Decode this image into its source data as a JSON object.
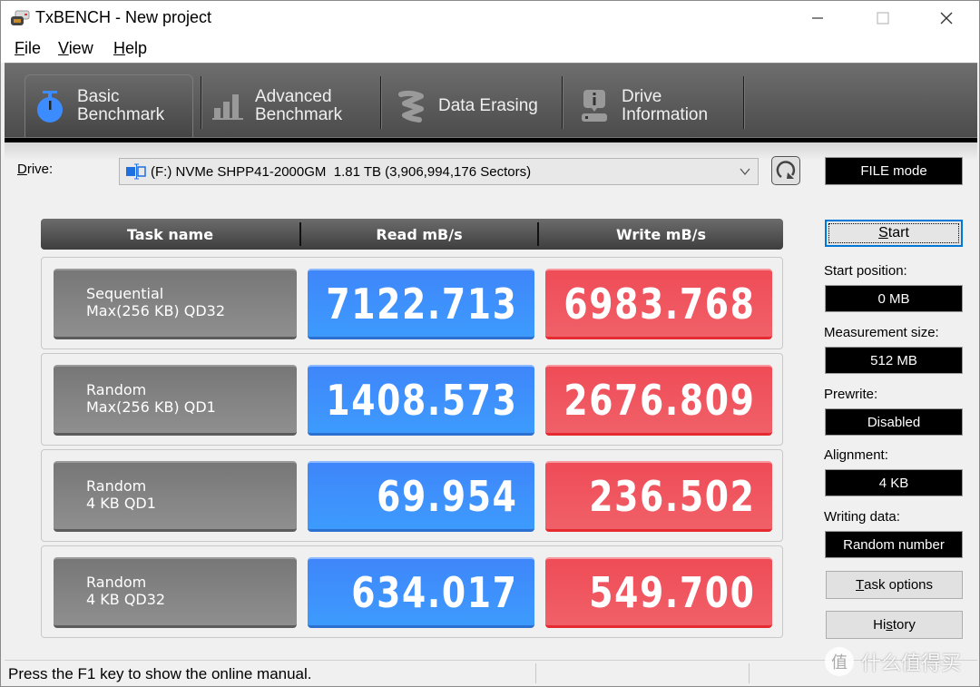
{
  "window": {
    "title": "TxBENCH - New project",
    "controls": {
      "minimize": "—",
      "maximize": "☐",
      "close": "✕"
    }
  },
  "menu": [
    {
      "accel": "F",
      "rest": "ile"
    },
    {
      "accel": "V",
      "rest": "iew"
    },
    {
      "accel": "H",
      "rest": "elp"
    }
  ],
  "tabs": [
    {
      "line1": "Basic",
      "line2": "Benchmark",
      "icon": "stopwatch-icon",
      "active": true
    },
    {
      "line1": "Advanced",
      "line2": "Benchmark",
      "icon": "bar-chart-icon",
      "active": false
    },
    {
      "line1": "Data Erasing",
      "line2": "",
      "icon": "eraser-spring-icon",
      "active": false
    },
    {
      "line1": "Drive",
      "line2": "Information",
      "icon": "drive-info-icon",
      "active": false
    }
  ],
  "drive": {
    "label_accel": "D",
    "label_rest": "rive:",
    "selected": "(F:) NVMe SHPP41-2000GM  1.81 TB (3,906,994,176 Sectors)"
  },
  "mode": "FILE mode",
  "table": {
    "headers": [
      "Task name",
      "Read mB/s",
      "Write mB/s"
    ],
    "rows": [
      {
        "name1": "Sequential",
        "name2": "Max(256 KB) QD32",
        "read": "7122.713",
        "write": "6983.768"
      },
      {
        "name1": "Random",
        "name2": "Max(256 KB) QD1",
        "read": "1408.573",
        "write": "2676.809"
      },
      {
        "name1": "Random",
        "name2": "4 KB QD1",
        "read": "69.954",
        "write": "236.502"
      },
      {
        "name1": "Random",
        "name2": "4 KB QD32",
        "read": "634.017",
        "write": "549.700"
      }
    ]
  },
  "panel": {
    "start_accel": "S",
    "start_rest": "tart",
    "start_position_label": "Start position:",
    "start_position": "0 MB",
    "measurement_size_label": "Measurement size:",
    "measurement_size": "512 MB",
    "prewrite_label": "Prewrite:",
    "prewrite": "Disabled",
    "alignment_label": "Alignment:",
    "alignment": "4 KB",
    "writing_data_label": "Writing data:",
    "writing_data": "Random number",
    "task_options_accel": "T",
    "task_options_rest": "ask options",
    "history_pre": "Hi",
    "history_accel": "s",
    "history_rest": "tory"
  },
  "status": {
    "text": "Press the F1 key to show the online manual."
  },
  "watermark": {
    "glyph": "值",
    "text": "什么值得买"
  },
  "colors": {
    "read": "#3f8cfb",
    "write": "#ef535d",
    "task": "#838383",
    "toolbar": "#5a5a5a",
    "accent": "#0078d7"
  }
}
